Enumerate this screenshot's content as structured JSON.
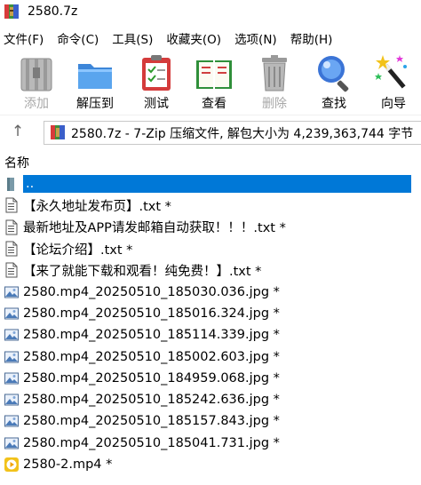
{
  "window": {
    "title": "2580.7z",
    "icon": "7zip-archive-icon"
  },
  "menu": [
    "文件(F)",
    "命令(C)",
    "工具(S)",
    "收藏夹(O)",
    "选项(N)",
    "帮助(H)"
  ],
  "toolbar": {
    "add": "添加",
    "extract": "解压到",
    "test": "测试",
    "view": "查看",
    "delete": "删除",
    "find": "查找",
    "wizard": "向导"
  },
  "address": {
    "path": "2580.7z - 7-Zip 压缩文件, 解包大小为 4,239,363,744 字节"
  },
  "columns": {
    "name": "名称"
  },
  "files": [
    {
      "name": "..",
      "icon": "folder-up-icon",
      "selected": true
    },
    {
      "name": "【永久地址发布页】.txt *",
      "icon": "text-file-icon"
    },
    {
      "name": "最新地址及APP请发邮箱自动获取！！！.txt *",
      "icon": "text-file-icon"
    },
    {
      "name": "【论坛介绍】.txt *",
      "icon": "text-file-icon"
    },
    {
      "name": "【来了就能下载和观看！纯免费！】.txt *",
      "icon": "text-file-icon"
    },
    {
      "name": "2580.mp4_20250510_185030.036.jpg *",
      "icon": "image-file-icon"
    },
    {
      "name": "2580.mp4_20250510_185016.324.jpg *",
      "icon": "image-file-icon"
    },
    {
      "name": "2580.mp4_20250510_185114.339.jpg *",
      "icon": "image-file-icon"
    },
    {
      "name": "2580.mp4_20250510_185002.603.jpg *",
      "icon": "image-file-icon"
    },
    {
      "name": "2580.mp4_20250510_184959.068.jpg *",
      "icon": "image-file-icon"
    },
    {
      "name": "2580.mp4_20250510_185242.636.jpg *",
      "icon": "image-file-icon"
    },
    {
      "name": "2580.mp4_20250510_185157.843.jpg *",
      "icon": "image-file-icon"
    },
    {
      "name": "2580.mp4_20250510_185041.731.jpg *",
      "icon": "image-file-icon"
    },
    {
      "name": "2580-2.mp4 *",
      "icon": "video-file-icon"
    }
  ],
  "colors": {
    "selection": "#0078d7",
    "disabled_text": "#a8a8a8"
  }
}
